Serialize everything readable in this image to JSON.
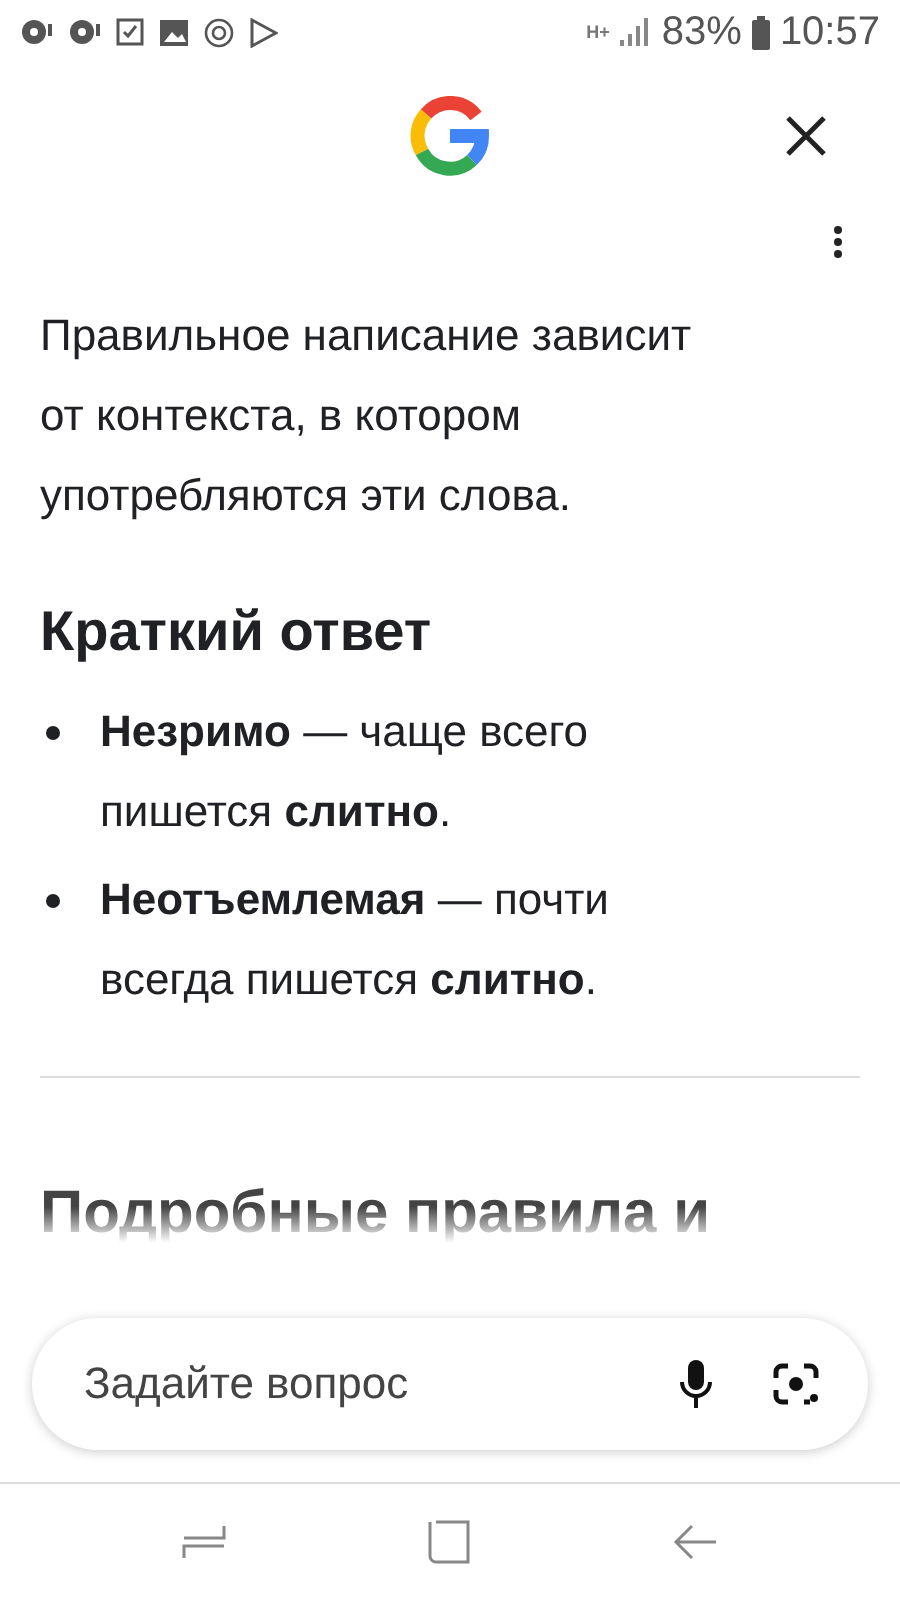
{
  "status_bar": {
    "network": "H+",
    "battery": "83%",
    "time": "10:57"
  },
  "answer": {
    "intro": "Правильное написание зависит от контекста, в котором употребляются эти слова.",
    "heading": "Краткий ответ",
    "bullets": [
      "**Незримо** — чаще всего пишется **слитно**.",
      "**Неотъемлемая** — почти всегда пишется **слитно**."
    ],
    "next_heading": "Подробные правила и"
  },
  "search": {
    "placeholder": "Задайте вопрос"
  }
}
